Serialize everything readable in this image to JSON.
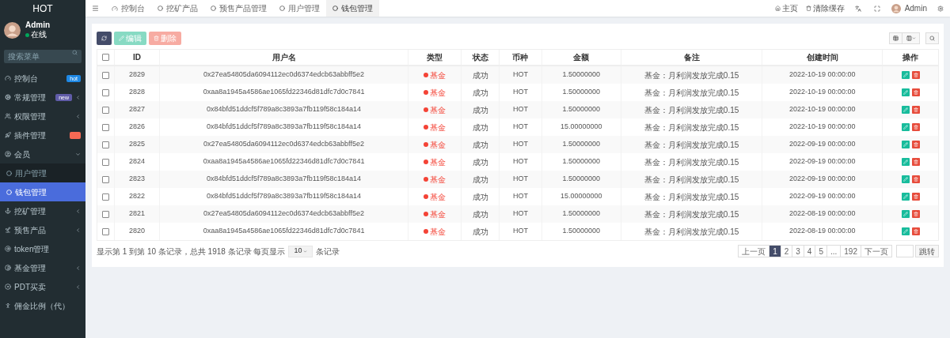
{
  "sidebar": {
    "logo": "HOT",
    "user": {
      "name": "Admin",
      "status": "在线",
      "online": true
    },
    "search": {
      "placeholder": "搜索菜单"
    },
    "items": [
      {
        "label": "控制台",
        "badge": {
          "text": "hot",
          "color": "#1e88e5"
        }
      },
      {
        "label": "常规管理",
        "badge": {
          "text": "new",
          "color": "#605ca8"
        },
        "expanded": false
      },
      {
        "label": "权限管理",
        "expanded": false
      },
      {
        "label": "插件管理",
        "badge": {
          "color": "#f56954"
        }
      },
      {
        "label": "会员",
        "expanded": true,
        "children": [
          {
            "label": "用户管理",
            "selected": false
          },
          {
            "label": "钱包管理",
            "selected": true
          }
        ]
      },
      {
        "label": "挖矿管理",
        "expanded": false
      },
      {
        "label": "预售产品",
        "expanded": false
      },
      {
        "label": "token管理"
      },
      {
        "label": "基金管理",
        "expanded": false
      },
      {
        "label": "PDT买卖",
        "expanded": false
      },
      {
        "label": "佣金比例（代）"
      }
    ]
  },
  "topbar": {
    "tabs": [
      {
        "label": "控制台",
        "selected": false
      },
      {
        "label": "挖矿产品",
        "selected": false
      },
      {
        "label": "预售产品管理",
        "selected": false
      },
      {
        "label": "用户管理",
        "selected": false
      },
      {
        "label": "钱包管理",
        "selected": true
      }
    ],
    "links": [
      {
        "label": "主页"
      },
      {
        "label": "清除缓存"
      }
    ],
    "user": "Admin"
  },
  "toolbar": {
    "buttons": [
      {
        "kind": "refresh",
        "disabled": false
      },
      {
        "kind": "edit",
        "label": "编辑",
        "disabled": true
      },
      {
        "kind": "delete",
        "label": "删除",
        "disabled": true
      }
    ]
  },
  "table": {
    "all_checked": false,
    "columns": [
      "ID",
      "用户名",
      "类型",
      "状态",
      "币种",
      "金额",
      "备注",
      "创建时间",
      "操作"
    ],
    "rows": [
      {
        "checked": false,
        "id": "2829",
        "username": "0x27ea54805da6094112ec0d6374edcb63abbff5e2",
        "type": {
          "label": "基金",
          "color": "#f44336"
        },
        "status": "成功",
        "currency": "HOT",
        "amount": "1.50000000",
        "remark": "基金：月利润发放完成0.15",
        "created": "2022-10-19 00:00:00"
      },
      {
        "checked": false,
        "id": "2828",
        "username": "0xaa8a1945a4586ae1065fd22346d81dfc7d0c7841",
        "type": {
          "label": "基金",
          "color": "#f44336"
        },
        "status": "成功",
        "currency": "HOT",
        "amount": "1.50000000",
        "remark": "基金：月利润发放完成0.15",
        "created": "2022-10-19 00:00:00"
      },
      {
        "checked": false,
        "id": "2827",
        "username": "0x84bfd51ddcf5f789a8c3893a7fb119f58c184a14",
        "type": {
          "label": "基金",
          "color": "#f44336"
        },
        "status": "成功",
        "currency": "HOT",
        "amount": "1.50000000",
        "remark": "基金：月利润发放完成0.15",
        "created": "2022-10-19 00:00:00"
      },
      {
        "checked": false,
        "id": "2826",
        "username": "0x84bfd51ddcf5f789a8c3893a7fb119f58c184a14",
        "type": {
          "label": "基金",
          "color": "#f44336"
        },
        "status": "成功",
        "currency": "HOT",
        "amount": "15.00000000",
        "remark": "基金：月利润发放完成0.15",
        "created": "2022-10-19 00:00:00"
      },
      {
        "checked": false,
        "id": "2825",
        "username": "0x27ea54805da6094112ec0d6374edcb63abbff5e2",
        "type": {
          "label": "基金",
          "color": "#f44336"
        },
        "status": "成功",
        "currency": "HOT",
        "amount": "1.50000000",
        "remark": "基金：月利润发放完成0.15",
        "created": "2022-09-19 00:00:00"
      },
      {
        "checked": false,
        "id": "2824",
        "username": "0xaa8a1945a4586ae1065fd22346d81dfc7d0c7841",
        "type": {
          "label": "基金",
          "color": "#f44336"
        },
        "status": "成功",
        "currency": "HOT",
        "amount": "1.50000000",
        "remark": "基金：月利润发放完成0.15",
        "created": "2022-09-19 00:00:00"
      },
      {
        "checked": false,
        "id": "2823",
        "username": "0x84bfd51ddcf5f789a8c3893a7fb119f58c184a14",
        "type": {
          "label": "基金",
          "color": "#f44336"
        },
        "status": "成功",
        "currency": "HOT",
        "amount": "1.50000000",
        "remark": "基金：月利润发放完成0.15",
        "created": "2022-09-19 00:00:00"
      },
      {
        "checked": false,
        "id": "2822",
        "username": "0x84bfd51ddcf5f789a8c3893a7fb119f58c184a14",
        "type": {
          "label": "基金",
          "color": "#f44336"
        },
        "status": "成功",
        "currency": "HOT",
        "amount": "15.00000000",
        "remark": "基金：月利润发放完成0.15",
        "created": "2022-09-19 00:00:00"
      },
      {
        "checked": false,
        "id": "2821",
        "username": "0x27ea54805da6094112ec0d6374edcb63abbff5e2",
        "type": {
          "label": "基金",
          "color": "#f44336"
        },
        "status": "成功",
        "currency": "HOT",
        "amount": "1.50000000",
        "remark": "基金：月利润发放完成0.15",
        "created": "2022-08-19 00:00:00"
      },
      {
        "checked": false,
        "id": "2820",
        "username": "0xaa8a1945a4586ae1065fd22346d81dfc7d0c7841",
        "type": {
          "label": "基金",
          "color": "#f44336"
        },
        "status": "成功",
        "currency": "HOT",
        "amount": "1.50000000",
        "remark": "基金：月利润发放完成0.15",
        "created": "2022-08-19 00:00:00"
      }
    ]
  },
  "pagination": {
    "summary": "显示第 1 到第 10 条记录，总共 1918 条记录 每页显示",
    "page_size": "10",
    "suffix": "条记录",
    "pages": [
      {
        "label": "上一页",
        "selected": false
      },
      {
        "label": "1",
        "selected": true
      },
      {
        "label": "2",
        "selected": false
      },
      {
        "label": "3",
        "selected": false
      },
      {
        "label": "4",
        "selected": false
      },
      {
        "label": "5",
        "selected": false
      },
      {
        "label": "...",
        "selected": false
      },
      {
        "label": "192",
        "selected": false
      },
      {
        "label": "下一页",
        "selected": false
      }
    ],
    "jump": "跳转"
  }
}
